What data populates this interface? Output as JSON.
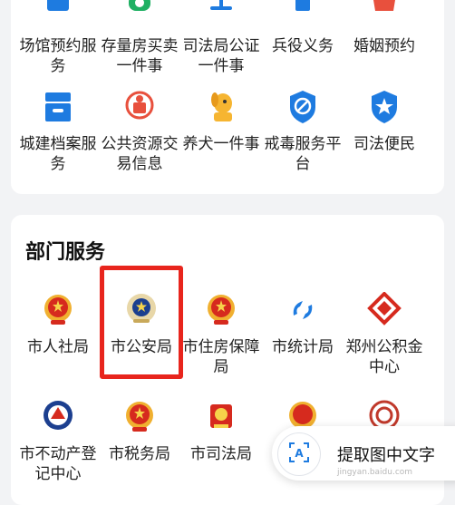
{
  "top_services": [
    {
      "label": "场馆预约服务",
      "icon": "venue-icon"
    },
    {
      "label": "存量房买卖一件事",
      "icon": "house-icon"
    },
    {
      "label": "司法局公证一件事",
      "icon": "scales-icon"
    },
    {
      "label": "兵役义务",
      "icon": "military-icon"
    },
    {
      "label": "婚姻预约",
      "icon": "marriage-icon"
    },
    {
      "label": "城建档案服务",
      "icon": "archive-icon"
    },
    {
      "label": "公共资源交易信息",
      "icon": "resource-icon"
    },
    {
      "label": "养犬一件事",
      "icon": "dog-icon"
    },
    {
      "label": "戒毒服务平台",
      "icon": "shield-icon"
    },
    {
      "label": "司法便民",
      "icon": "justice-icon"
    }
  ],
  "department": {
    "title": "部门服务",
    "items": [
      {
        "label": "市人社局",
        "icon": "national-emblem-icon"
      },
      {
        "label": "市公安局",
        "icon": "police-emblem-icon"
      },
      {
        "label": "市住房保障局",
        "icon": "national-emblem-icon"
      },
      {
        "label": "市统计局",
        "icon": "statistics-icon"
      },
      {
        "label": "郑州公积金中心",
        "icon": "housing-fund-icon"
      },
      {
        "label": "市不动产登记中心",
        "icon": "real-estate-icon"
      },
      {
        "label": "市税务局",
        "icon": "national-emblem-icon"
      },
      {
        "label": "市司法局",
        "icon": "justice-emblem-icon"
      },
      {
        "label": "",
        "icon": "national-emblem-icon"
      },
      {
        "label": "",
        "icon": "ornament-icon"
      }
    ]
  },
  "floating_action": {
    "label": "提取图中文字",
    "icon": "text-scan-icon"
  },
  "watermark": "jingyan.baidu.com",
  "colors": {
    "highlight": "#e8251d",
    "blue": "#1e7be0",
    "red": "#e8251d",
    "gold": "#f6b531"
  }
}
